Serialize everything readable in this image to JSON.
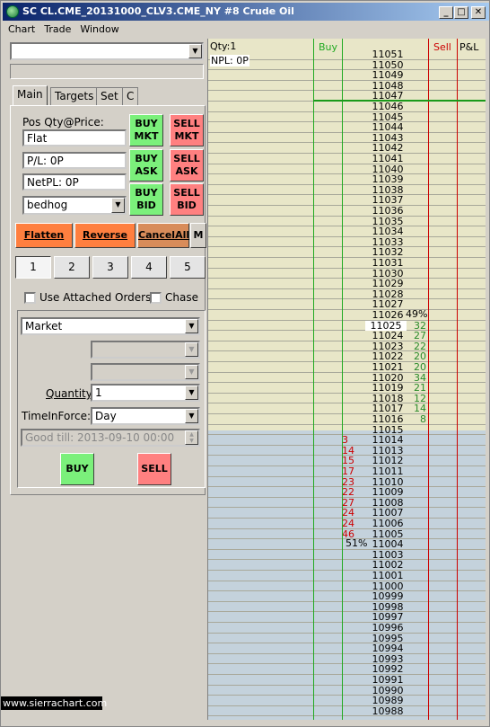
{
  "window": {
    "title": "SC CL.CME_20131000_CLV3.CME_NY  #8  Crude Oil"
  },
  "menu": [
    "Chart",
    "Trade",
    "Window"
  ],
  "tabs": [
    "Main",
    "Targets",
    "Set",
    "C"
  ],
  "position": {
    "label": "Pos Qty@Price:",
    "value": "Flat",
    "pl": "P/L: 0P",
    "netpl": "NetPL: 0P",
    "account": "bedhog"
  },
  "order_buttons": {
    "buy_mkt": [
      "BUY",
      "MKT"
    ],
    "sell_mkt": [
      "SELL",
      "MKT"
    ],
    "buy_ask": [
      "BUY",
      "ASK"
    ],
    "sell_ask": [
      "SELL",
      "ASK"
    ],
    "buy_bid": [
      "BUY",
      "BID"
    ],
    "sell_bid": [
      "SELL",
      "BID"
    ]
  },
  "actions": {
    "flatten": "Flatten",
    "reverse": "Reverse",
    "cancel_all": "CancelAll",
    "more": "M"
  },
  "quantity_presets": [
    "1",
    "2",
    "3",
    "4",
    "5"
  ],
  "options": {
    "attached_orders": "Use Attached Orders",
    "chase": "Chase"
  },
  "order_entry": {
    "order_type": "Market",
    "quantity_label": "Quantity:",
    "quantity": "1",
    "tif_label": "TimeInForce:",
    "tif": "Day",
    "good_till": "Good till: 2013-09-10 00:00",
    "buy_label": "BUY",
    "sell_label": "SELL"
  },
  "ladder": {
    "qty": "Qty:1",
    "npl": "NPL: 0P",
    "buy_header": "Buy",
    "sell_header": "Sell",
    "pl_header": "P&L",
    "last_price": "11025",
    "ask_pct": "49%",
    "bid_pct": "51%",
    "rows": [
      {
        "p": "11051"
      },
      {
        "p": "11050"
      },
      {
        "p": "11049"
      },
      {
        "p": "11048"
      },
      {
        "p": "11047"
      },
      {
        "p": "11046"
      },
      {
        "p": "11045"
      },
      {
        "p": "11044"
      },
      {
        "p": "11043"
      },
      {
        "p": "11042"
      },
      {
        "p": "11041"
      },
      {
        "p": "11040"
      },
      {
        "p": "11039"
      },
      {
        "p": "11038"
      },
      {
        "p": "11037"
      },
      {
        "p": "11036"
      },
      {
        "p": "11035"
      },
      {
        "p": "11034"
      },
      {
        "p": "11033"
      },
      {
        "p": "11032"
      },
      {
        "p": "11031"
      },
      {
        "p": "11030"
      },
      {
        "p": "11029"
      },
      {
        "p": "11028"
      },
      {
        "p": "11027"
      },
      {
        "p": "11026"
      },
      {
        "p": "11025",
        "a": "32"
      },
      {
        "p": "11024",
        "a": "27"
      },
      {
        "p": "11023",
        "a": "22"
      },
      {
        "p": "11022",
        "a": "20"
      },
      {
        "p": "11021",
        "a": "20"
      },
      {
        "p": "11020",
        "a": "34"
      },
      {
        "p": "11019",
        "a": "21"
      },
      {
        "p": "11018",
        "a": "12"
      },
      {
        "p": "11017",
        "a": "14"
      },
      {
        "p": "11016",
        "a": "8"
      },
      {
        "p": "11015"
      },
      {
        "p": "11014",
        "b": "3"
      },
      {
        "p": "11013",
        "b": "14"
      },
      {
        "p": "11012",
        "b": "15"
      },
      {
        "p": "11011",
        "b": "17"
      },
      {
        "p": "11010",
        "b": "23"
      },
      {
        "p": "11009",
        "b": "22"
      },
      {
        "p": "11008",
        "b": "27"
      },
      {
        "p": "11007",
        "b": "24"
      },
      {
        "p": "11006",
        "b": "24"
      },
      {
        "p": "11005",
        "b": "46"
      },
      {
        "p": "11004"
      },
      {
        "p": "11003"
      },
      {
        "p": "11002"
      },
      {
        "p": "11001"
      },
      {
        "p": "11000"
      },
      {
        "p": "10999"
      },
      {
        "p": "10998"
      },
      {
        "p": "10997"
      },
      {
        "p": "10996"
      },
      {
        "p": "10995"
      },
      {
        "p": "10994"
      },
      {
        "p": "10993"
      },
      {
        "p": "10992"
      },
      {
        "p": "10991"
      },
      {
        "p": "10990"
      },
      {
        "p": "10989"
      },
      {
        "p": "10988"
      }
    ]
  },
  "watermark": "www.sierrachart.com",
  "colors": {
    "ask_bg": "#e8e6c8",
    "bid_bg": "#c4d2dc",
    "buy": "#7bf07b",
    "sell": "#ff8080",
    "orange": "#ff7f3f",
    "buyline": "#22aa22",
    "sellline": "#cc0000",
    "title": "#0a246a"
  }
}
